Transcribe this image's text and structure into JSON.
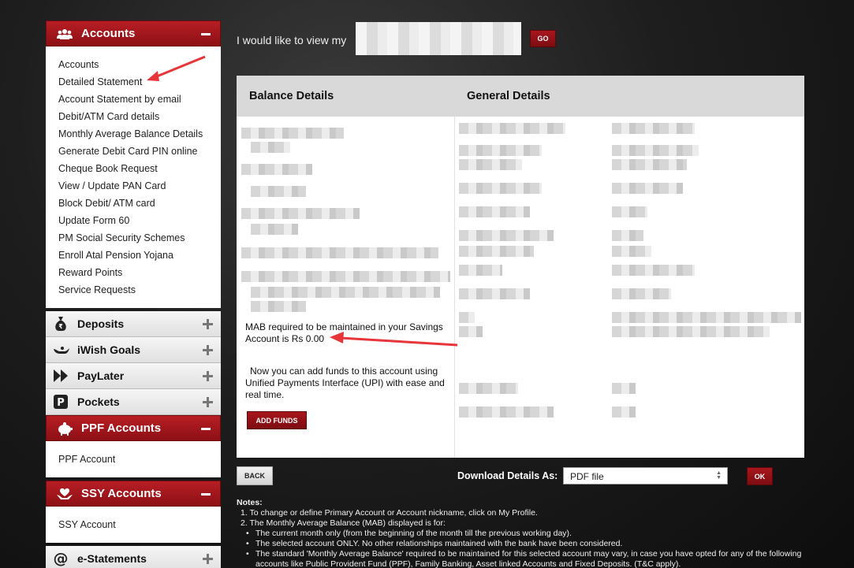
{
  "sidebar": {
    "accounts": {
      "title": "Accounts",
      "items": [
        "Accounts",
        "Detailed Statement",
        "Account Statement by email",
        "Debit/ATM Card details",
        "Monthly Average Balance Details",
        "Generate Debit Card PIN online",
        "Cheque Book Request",
        "View / Update PAN Card",
        "Block Debit/ ATM card",
        "Update Form 60",
        "PM Social Security Schemes",
        "Enroll Atal Pension Yojana",
        "Reward Points",
        "Service Requests"
      ]
    },
    "deposits": "Deposits",
    "iwish": "iWish Goals",
    "paylater": "PayLater",
    "pockets": "Pockets",
    "ppf": {
      "title": "PPF Accounts",
      "items": [
        "PPF Account"
      ]
    },
    "ssy": {
      "title": "SSY Accounts",
      "items": [
        "SSY Account"
      ]
    },
    "estatements": "e-Statements"
  },
  "top": {
    "view_label": "I would like to view my",
    "go_label": "GO"
  },
  "panel": {
    "balance_title": "Balance Details",
    "general_title": "General Details",
    "mab_text": "MAB required to be maintained in your Savings Account is Rs 0.00",
    "upi_text": "Now you can add funds to this account using Unified Payments Interface (UPI) with ease and real time.",
    "add_funds_label": "ADD FUNDS"
  },
  "bottom": {
    "back_label": "BACK",
    "download_label": "Download Details As:",
    "format_selected": "PDF file",
    "ok_label": "OK"
  },
  "notes": {
    "title": "Notes:",
    "n1": "1. To change or define Primary Account or Account nickname, click on My Profile.",
    "n2": "2. The Monthly Average Balance (MAB) displayed is for:",
    "b1": "The current month only (from the beginning of the month till the previous working day).",
    "b2": "The selected account ONLY. No other relationships maintained with the bank have been considered.",
    "b3": "The standard 'Monthly Average Balance' required to be maintained for this selected account may vary, in case you have opted for any of the following accounts like Public Provident Fund (PPF), Family Banking, Asset linked Accounts and Fixed Deposits. (T&C apply)."
  },
  "colors": {
    "brand_red": "#b71e24",
    "annotation_arrow": "#e8353a"
  }
}
